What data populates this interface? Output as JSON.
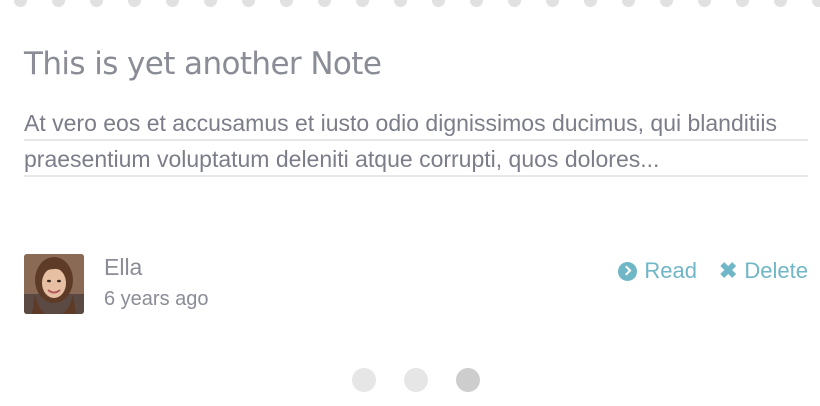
{
  "note": {
    "title": "This is yet another Note",
    "excerpt": "At vero eos et accusamus et iusto odio dignissimos ducimus, qui blanditiis praesentium voluptatum deleniti atque corrupti, quos dolores..."
  },
  "author": {
    "name": "Ella",
    "posted": "6 years ago",
    "avatar_icon": "user-photo"
  },
  "actions": {
    "read_label": "Read",
    "read_icon": "chevron-circle-right-icon",
    "delete_label": "Delete",
    "delete_icon": "close-icon"
  },
  "pager": {
    "pages": 3,
    "current": 3
  },
  "colors": {
    "accent": "#6fb6c6",
    "text": "#8a8c96",
    "rule": "#e6e8ea"
  }
}
